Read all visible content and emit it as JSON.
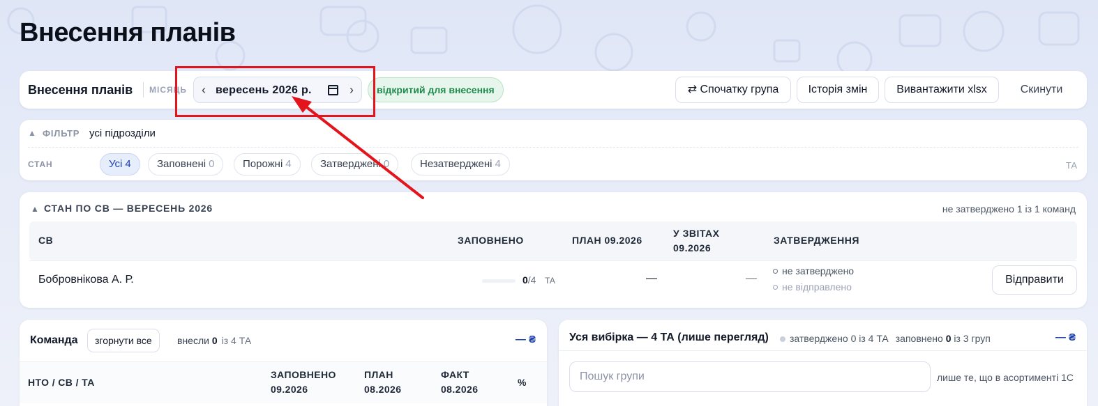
{
  "page": {
    "title": "Внесення планів"
  },
  "toolbar": {
    "title": "Внесення планів",
    "month_label": "МІСЯЦЬ",
    "month_value": "вересень  2026 р.",
    "status_badge": "відкритий для внесення",
    "group_first_button": "⇄ Спочатку група",
    "history_button": "Історія змін",
    "export_button": "Вивантажити xlsx",
    "reset_button": "Скинути"
  },
  "filter": {
    "label": "ФІЛЬТР",
    "value": "усі підрозділи",
    "state_label": "СТАН",
    "chips": [
      {
        "label": "Усі",
        "count": "4"
      },
      {
        "label": "Заповнені",
        "count": "0"
      },
      {
        "label": "Порожні",
        "count": "4"
      },
      {
        "label": "Затверджені",
        "count": "0"
      },
      {
        "label": "Незатверджені",
        "count": "4"
      }
    ],
    "ta_label": "ТА"
  },
  "sv_status": {
    "title": "СТАН ПО СВ — ВЕРЕСЕНЬ 2026",
    "meta": "не затверджено 1 із 1 команд",
    "columns": {
      "sv": "СВ",
      "filled": "ЗАПОВНЕНО",
      "plan": "ПЛАН 09.2026",
      "reports": "У ЗВІТАХ 09.2026",
      "approval": "ЗАТВЕРДЖЕННЯ"
    },
    "rows": [
      {
        "name": "Бобровнікова А. Р.",
        "filled_done": "0",
        "filled_total": "/4",
        "filled_fraction": 0,
        "unit": "ТА",
        "plan": "—",
        "reports": "—",
        "approval_status": "не затверджено",
        "send_status": "не відправлено",
        "send_button": "Відправити"
      }
    ]
  },
  "team": {
    "title": "Команда",
    "collapse_button": "згорнути все",
    "entered_prefix": "внесли",
    "entered_value": "0",
    "entered_total": "із 4 ТА",
    "sum": "— ₴",
    "columns": {
      "name": "НТО / СВ / ТА",
      "filled": "ЗАПОВНЕНО 09.2026",
      "plan": "ПЛАН 08.2026",
      "fact": "ФАКТ 08.2026",
      "pct": "%"
    }
  },
  "sample": {
    "title": "Уся вибірка — 4 ТА (лише перегляд)",
    "approved_prefix": "затверджено 0 із 4 ТА",
    "filled_prefix": "заповнено",
    "filled_value": "0",
    "groups": "із 3 груп",
    "sum": "— ₴",
    "search_placeholder": "Пошук групи",
    "hint": "лише те, що в асортименті 1С"
  },
  "colors": {
    "accent": "#1e40af",
    "success": "#1f8a4c",
    "annotation": "#e3141b"
  }
}
